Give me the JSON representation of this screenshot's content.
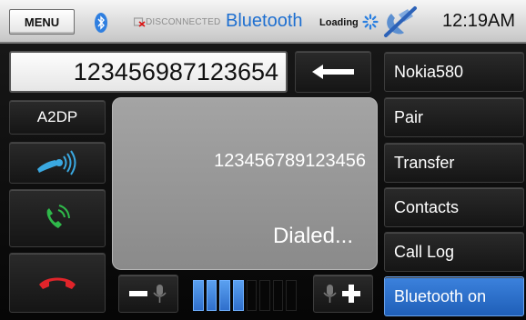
{
  "status_bar": {
    "menu_label": "MENU",
    "connection_status": "DISCONNECTED",
    "title": "Bluetooth",
    "loading_label": "Loading",
    "time": "12:19AM",
    "icons": [
      "bluetooth-icon",
      "disconnected-icon",
      "loading-spinner-icon",
      "phone-disabled-icon"
    ]
  },
  "dialer": {
    "input_value": "123456987123654",
    "backspace_icon": "arrow-left-icon"
  },
  "left_buttons": [
    {
      "label": "A2DP"
    },
    {
      "icon": "handsfree-audio-icon"
    },
    {
      "icon": "answer-call-icon"
    },
    {
      "icon": "end-call-icon"
    }
  ],
  "display": {
    "number": "123456789123456",
    "status": "Dialed..."
  },
  "right_buttons": [
    {
      "label": "Nokia580"
    },
    {
      "label": "Pair"
    },
    {
      "label": "Transfer"
    },
    {
      "label": "Contacts"
    },
    {
      "label": "Call Log"
    },
    {
      "label": "Bluetooth on"
    }
  ],
  "volume": {
    "segments_total": 8,
    "segments_filled": 4,
    "minus_icon": "mic-volume-down-icon",
    "plus_icon": "mic-volume-up-icon"
  },
  "colors": {
    "accent_blue": "#1e6fd0",
    "bluetooth_on_button": "#2f74d0",
    "answer_green": "#2fb84a",
    "end_red": "#e0242a",
    "panel_gray": "#989898"
  }
}
